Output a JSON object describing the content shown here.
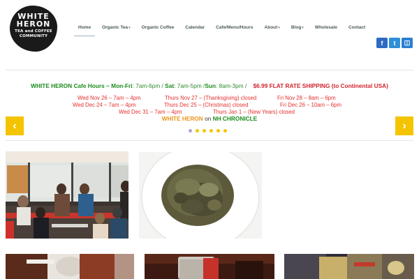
{
  "logo": {
    "line1": "WHITE",
    "line2": "HERON",
    "line3": "TEA and COFFEE",
    "line4": "COMMUNITY"
  },
  "nav": {
    "items": [
      {
        "label": "Home",
        "active": true,
        "dropdown": false
      },
      {
        "label": "Organic Tea",
        "dropdown": true
      },
      {
        "label": "Organic Coffee",
        "dropdown": false
      },
      {
        "label": "Calendar",
        "dropdown": false
      },
      {
        "label": "Cafe/Menu/Hours",
        "dropdown": false
      },
      {
        "label": "About",
        "dropdown": true
      },
      {
        "label": "Blog",
        "dropdown": true
      },
      {
        "label": "Wholesale",
        "dropdown": false
      },
      {
        "label": "Contact",
        "dropdown": false
      }
    ],
    "dropdown_caret": "▾"
  },
  "social": {
    "facebook": "f",
    "twitter": "t",
    "instagram": "◫"
  },
  "announcement": {
    "brand": "WHITE HERON",
    "cafe_hours_label": "Cafe Hours ~",
    "monfri_label": "Mon-Fri",
    "monfri_hours": ": 7am-6pm",
    "slash1": " / ",
    "sat_label": "Sat",
    "sat_hours": ": 7am-5pm",
    "slash2": " /",
    "sun_label": "Sun",
    "sun_hours": ": 8am-3pm",
    "slash3": " /",
    "shipping": "$6.99 FLAT RATE SHIPPING (to Continental USA)"
  },
  "holiday_hours": {
    "nov26": "Wed Nov 26 – 7am – 4pm",
    "nov27": "Thurs Nov 27 – (Thanksgiving) closed",
    "nov28": "Fri Nov 28 – 8am – 6pm",
    "dec24": "Wed Dec 24 – 7am – 4pm",
    "dec25": "Thurs Dec 25 – (Christmas) closed",
    "dec26": "Fri Dec 26 – 10am – 6pm",
    "dec31": "Wed Dec 31 – 7am – 4pm",
    "jan1": "Thurs Jan 1 – (New Years) closed"
  },
  "chronicle": {
    "brand": "WHITE HERON",
    "on": "on",
    "show": "NH CHRONICLE"
  },
  "slider": {
    "prev_icon": "‹",
    "next_icon": "›",
    "active_dot": 0,
    "dot_count": 6
  },
  "colors": {
    "accent_yellow": "#f5c400",
    "nav_text": "#4a5a58",
    "green": "#1c8c1c",
    "red": "#d2242d",
    "orange": "#e8951d"
  }
}
